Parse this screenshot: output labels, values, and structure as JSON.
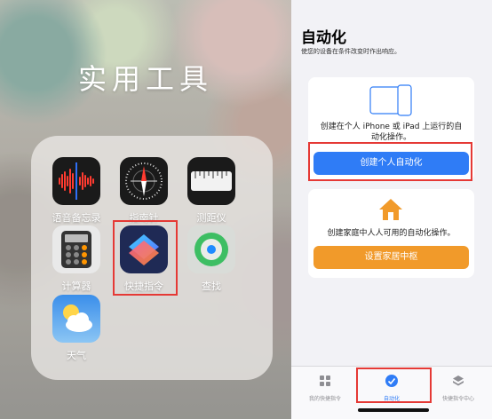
{
  "folder": {
    "title": "实用工具",
    "apps": [
      {
        "label": "语音备忘录",
        "icon": "voice-memos-icon"
      },
      {
        "label": "指南针",
        "icon": "compass-icon"
      },
      {
        "label": "测距仪",
        "icon": "measure-icon"
      },
      {
        "label": "计算器",
        "icon": "calculator-icon"
      },
      {
        "label": "快捷指令",
        "icon": "shortcuts-icon"
      },
      {
        "label": "查找",
        "icon": "find-my-icon"
      },
      {
        "label": "天气",
        "icon": "weather-icon"
      }
    ]
  },
  "automation": {
    "title": "自动化",
    "subtitle": "使您的设备在条件改变时作出响应。",
    "personal_card": {
      "text": "创建在个人 iPhone 或 iPad 上运行的自动化操作。",
      "button": "创建个人自动化"
    },
    "home_card": {
      "text": "创建家庭中人人可用的自动化操作。",
      "button": "设置家居中枢"
    }
  },
  "tabbar": {
    "tabs": [
      {
        "label": "我的快捷指令",
        "icon": "grid-icon"
      },
      {
        "label": "自动化",
        "icon": "automation-icon",
        "active": true
      },
      {
        "label": "快捷指令中心",
        "icon": "gallery-icon"
      }
    ]
  },
  "colors": {
    "accent_blue": "#2f7cf6",
    "accent_orange": "#f19a2a",
    "highlight_red": "#e53935"
  }
}
